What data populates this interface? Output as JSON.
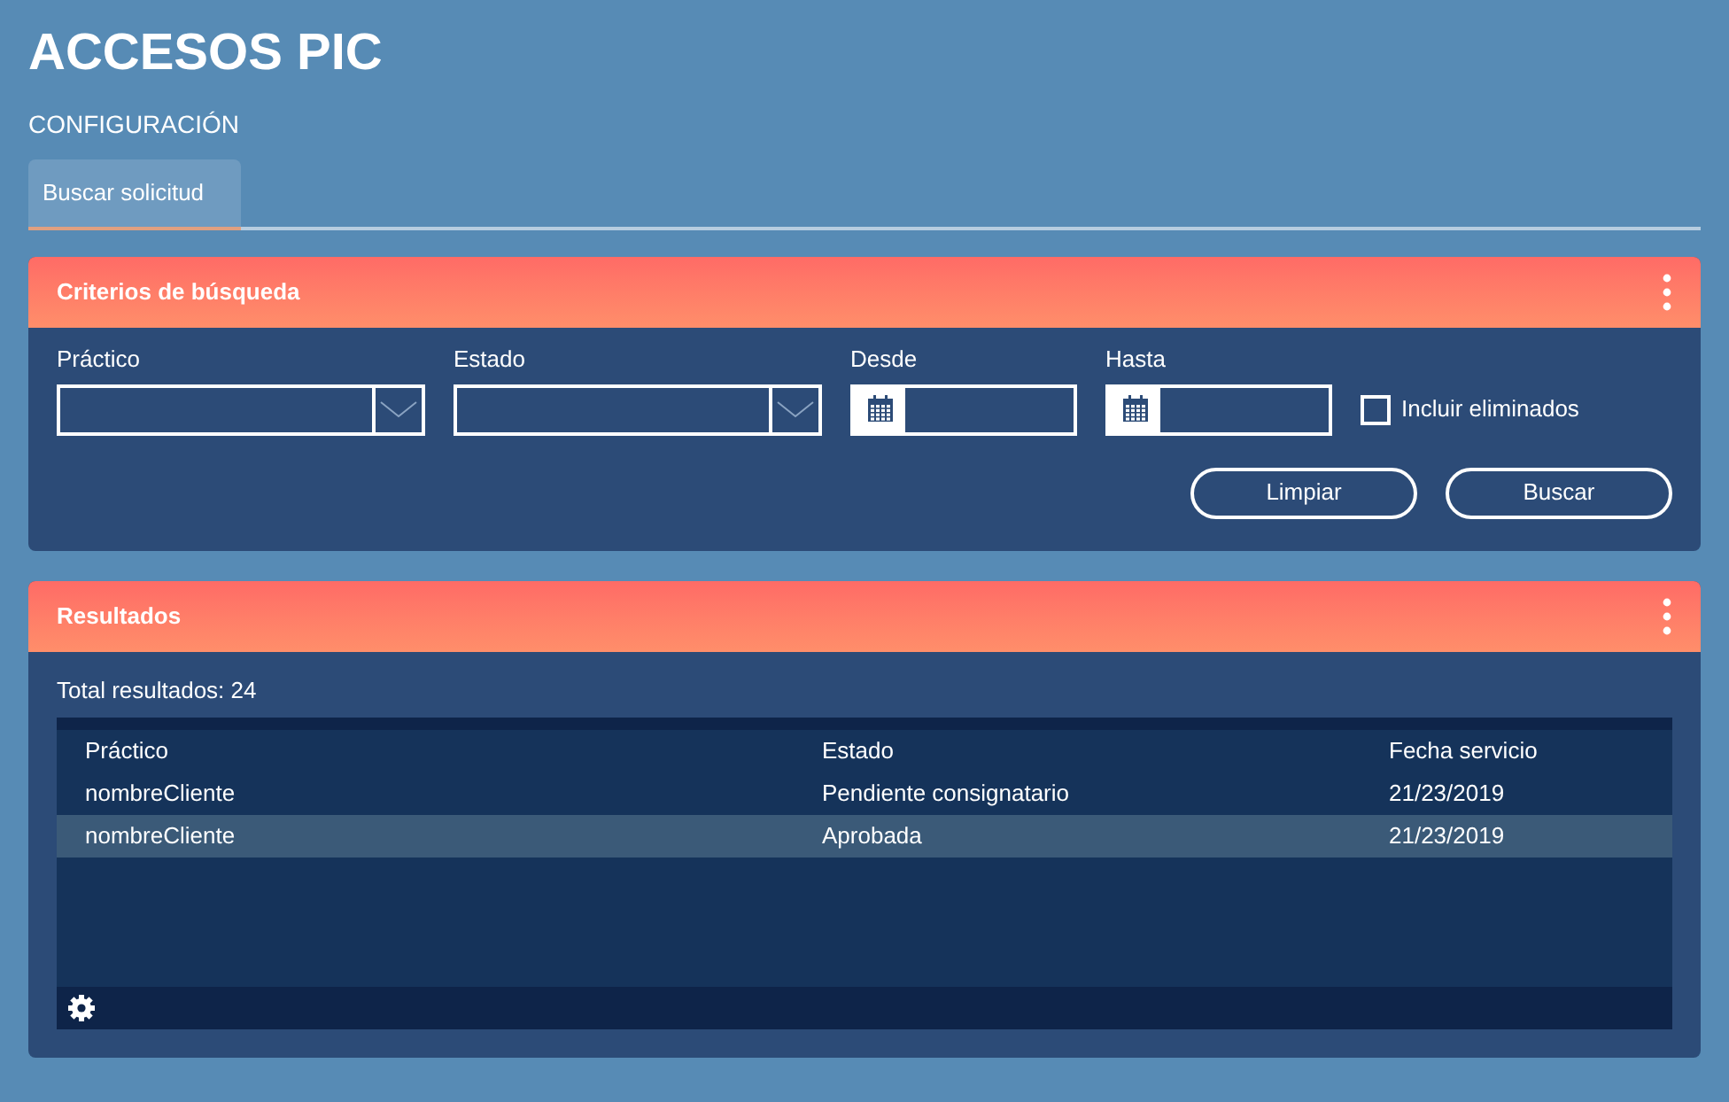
{
  "title": "ACCESOS PIC",
  "subtitle": "CONFIGURACIÓN",
  "tabs": [
    {
      "label": "Buscar solicitud",
      "selected": true
    }
  ],
  "search_panel": {
    "title": "Criterios de búsqueda",
    "fields": [
      {
        "kind": "select",
        "label": "Práctico"
      },
      {
        "kind": "select",
        "label": "Estado"
      },
      {
        "kind": "date",
        "label": "Desde"
      },
      {
        "kind": "date",
        "label": "Hasta"
      }
    ],
    "checkbox": {
      "label": "Incluir eliminados",
      "checked": false
    },
    "buttons": [
      "Limpiar",
      "Buscar"
    ]
  },
  "results_panel": {
    "title": "Resultados",
    "total": "Total resultados: 24",
    "table": {
      "columns": [
        "Práctico",
        "Estado",
        "Fecha servicio"
      ],
      "rows": [
        {
          "cells": [
            "nombreCliente",
            "Pendiente consignatario",
            "21/23/2019"
          ],
          "selected": false
        },
        {
          "cells": [
            "nombreCliente",
            "Aprobada",
            "21/23/2019"
          ],
          "selected": true
        }
      ]
    }
  }
}
